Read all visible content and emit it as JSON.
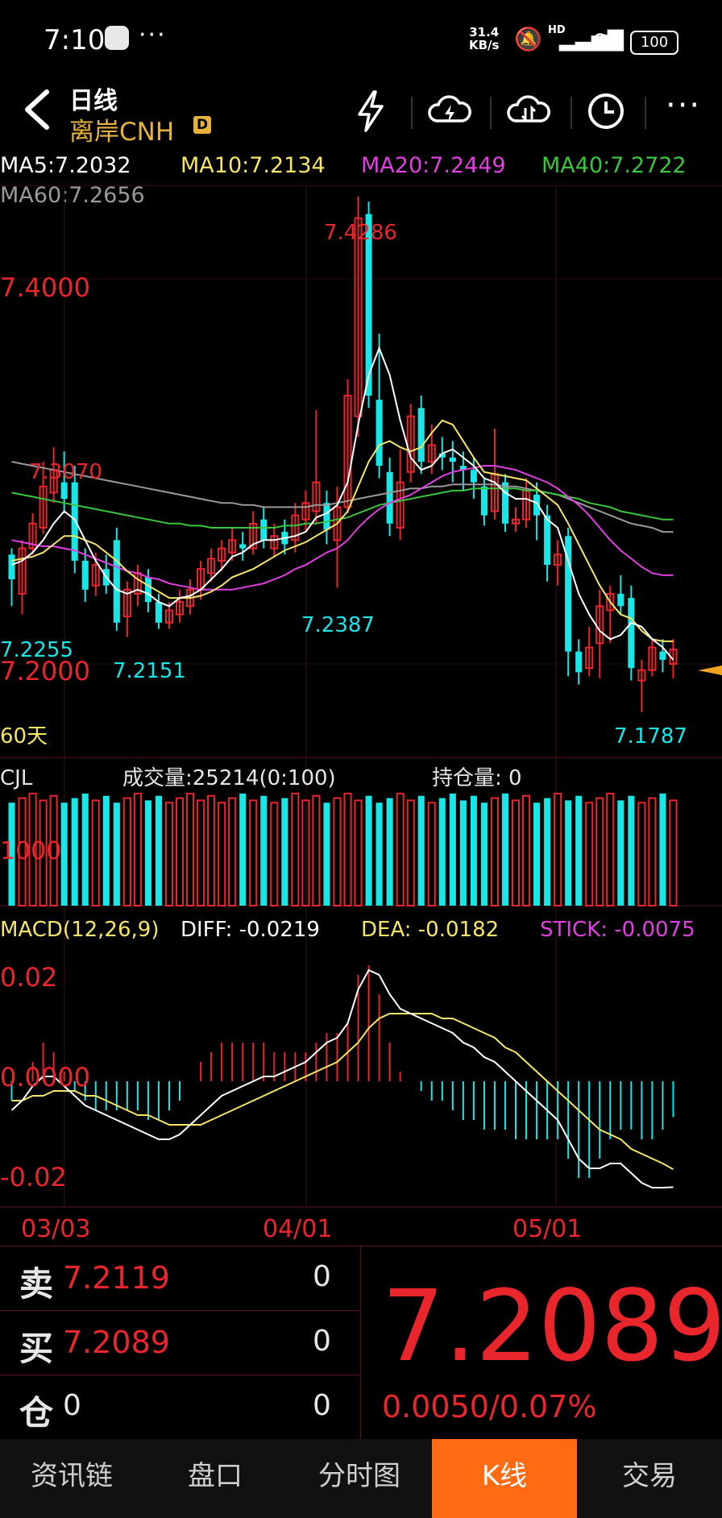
{
  "status_bar": {
    "time": "7:10",
    "net_rate_top": "31.4",
    "net_rate_bottom": "KB/s",
    "signal": "HD",
    "battery": "100"
  },
  "header": {
    "line1": "日线",
    "line2": "离岸CNH",
    "badge": "D"
  },
  "ma_line1": [
    {
      "label": "MA5:7.2032",
      "color": "#ffffff"
    },
    {
      "label": "MA10:7.2134",
      "color": "#f5e66a"
    },
    {
      "label": "MA20:7.2449",
      "color": "#e040e0"
    },
    {
      "label": "MA40:7.2722",
      "color": "#3cc43c"
    }
  ],
  "ma_line2": {
    "label": "MA60:7.2656",
    "color": "#9a9a9a"
  },
  "price_axis": {
    "top_label": "7.4000",
    "bottom_label": "7.2000",
    "period": "60天"
  },
  "price_annotations": {
    "high": "7.4286",
    "p1": "7.3070",
    "p2": "7.2387",
    "p3": "7.2255",
    "p4": "7.2151",
    "low": "7.1787"
  },
  "volume": {
    "title": "CJL",
    "volume_text": "成交量:25214(0:100)",
    "oi_text": "持仓量: 0",
    "axis_label": "1000"
  },
  "macd": {
    "title": "MACD(12,26,9)",
    "diff": "DIFF: -0.0219",
    "dea": "DEA: -0.0182",
    "stick": "STICK: -0.0075",
    "axis_top": "0.02",
    "axis_mid": "0.0000",
    "axis_bottom": "-0.02"
  },
  "dates": [
    "03/03",
    "04/01",
    "05/01"
  ],
  "quote": {
    "sell_label": "卖",
    "sell_price": "7.2119",
    "sell_vol": "0",
    "buy_label": "买",
    "buy_price": "7.2089",
    "buy_vol": "0",
    "pos_label": "仓",
    "pos_value": "0",
    "pos_vol": "0",
    "last_price": "7.2089",
    "change": "0.0050/0.07%"
  },
  "nav": [
    {
      "label": "资讯链",
      "active": false
    },
    {
      "label": "盘口",
      "active": false
    },
    {
      "label": "分时图",
      "active": false
    },
    {
      "label": "K线",
      "active": true
    },
    {
      "label": "交易",
      "active": false
    }
  ],
  "colors": {
    "up": "#e8262b",
    "down": "#19e6e6",
    "accent": "#e7b23c",
    "nav_active": "#ff6a13"
  },
  "chart_data": {
    "type": "candlestick",
    "price_ylim": [
      7.17,
      7.43
    ],
    "x_ticks": [
      "03/03",
      "04/01",
      "05/01"
    ],
    "candles": [
      {
        "o": 7.255,
        "c": 7.243,
        "h": 7.258,
        "l": 7.23
      },
      {
        "o": 7.236,
        "c": 7.258,
        "h": 7.262,
        "l": 7.226
      },
      {
        "o": 7.258,
        "c": 7.27,
        "h": 7.275,
        "l": 7.255
      },
      {
        "o": 7.268,
        "c": 7.288,
        "h": 7.3,
        "l": 7.265
      },
      {
        "o": 7.285,
        "c": 7.296,
        "h": 7.307,
        "l": 7.28
      },
      {
        "o": 7.29,
        "c": 7.282,
        "h": 7.305,
        "l": 7.275
      },
      {
        "o": 7.29,
        "c": 7.252,
        "h": 7.298,
        "l": 7.246
      },
      {
        "o": 7.252,
        "c": 7.238,
        "h": 7.258,
        "l": 7.232
      },
      {
        "o": 7.24,
        "c": 7.25,
        "h": 7.256,
        "l": 7.235
      },
      {
        "o": 7.248,
        "c": 7.24,
        "h": 7.255,
        "l": 7.236
      },
      {
        "o": 7.262,
        "c": 7.222,
        "h": 7.268,
        "l": 7.218
      },
      {
        "o": 7.225,
        "c": 7.238,
        "h": 7.242,
        "l": 7.215
      },
      {
        "o": 7.236,
        "c": 7.246,
        "h": 7.25,
        "l": 7.23
      },
      {
        "o": 7.244,
        "c": 7.232,
        "h": 7.248,
        "l": 7.227
      },
      {
        "o": 7.232,
        "c": 7.222,
        "h": 7.236,
        "l": 7.219
      },
      {
        "o": 7.222,
        "c": 7.228,
        "h": 7.232,
        "l": 7.219
      },
      {
        "o": 7.226,
        "c": 7.232,
        "h": 7.238,
        "l": 7.222
      },
      {
        "o": 7.23,
        "c": 7.238,
        "h": 7.243,
        "l": 7.226
      },
      {
        "o": 7.238,
        "c": 7.248,
        "h": 7.252,
        "l": 7.233
      },
      {
        "o": 7.246,
        "c": 7.253,
        "h": 7.258,
        "l": 7.242
      },
      {
        "o": 7.252,
        "c": 7.258,
        "h": 7.262,
        "l": 7.247
      },
      {
        "o": 7.256,
        "c": 7.262,
        "h": 7.268,
        "l": 7.252
      },
      {
        "o": 7.26,
        "c": 7.258,
        "h": 7.266,
        "l": 7.252
      },
      {
        "o": 7.258,
        "c": 7.27,
        "h": 7.276,
        "l": 7.255
      },
      {
        "o": 7.272,
        "c": 7.262,
        "h": 7.278,
        "l": 7.258
      },
      {
        "o": 7.258,
        "c": 7.264,
        "h": 7.27,
        "l": 7.254
      },
      {
        "o": 7.266,
        "c": 7.26,
        "h": 7.272,
        "l": 7.255
      },
      {
        "o": 7.262,
        "c": 7.274,
        "h": 7.28,
        "l": 7.256
      },
      {
        "o": 7.272,
        "c": 7.28,
        "h": 7.286,
        "l": 7.266
      },
      {
        "o": 7.276,
        "c": 7.29,
        "h": 7.325,
        "l": 7.27
      },
      {
        "o": 7.28,
        "c": 7.267,
        "h": 7.286,
        "l": 7.26
      },
      {
        "o": 7.262,
        "c": 7.278,
        "h": 7.288,
        "l": 7.239
      },
      {
        "o": 7.278,
        "c": 7.332,
        "h": 7.34,
        "l": 7.275
      },
      {
        "o": 7.322,
        "c": 7.418,
        "h": 7.4286,
        "l": 7.312
      },
      {
        "o": 7.42,
        "c": 7.332,
        "h": 7.426,
        "l": 7.326
      },
      {
        "o": 7.33,
        "c": 7.298,
        "h": 7.362,
        "l": 7.292
      },
      {
        "o": 7.295,
        "c": 7.27,
        "h": 7.302,
        "l": 7.264
      },
      {
        "o": 7.268,
        "c": 7.29,
        "h": 7.306,
        "l": 7.262
      },
      {
        "o": 7.295,
        "c": 7.322,
        "h": 7.328,
        "l": 7.29
      },
      {
        "o": 7.326,
        "c": 7.3,
        "h": 7.332,
        "l": 7.294
      },
      {
        "o": 7.3,
        "c": 7.308,
        "h": 7.318,
        "l": 7.294
      },
      {
        "o": 7.304,
        "c": 7.302,
        "h": 7.312,
        "l": 7.296
      },
      {
        "o": 7.302,
        "c": 7.3,
        "h": 7.31,
        "l": 7.29
      },
      {
        "o": 7.298,
        "c": 7.296,
        "h": 7.305,
        "l": 7.286
      },
      {
        "o": 7.296,
        "c": 7.29,
        "h": 7.302,
        "l": 7.282
      },
      {
        "o": 7.288,
        "c": 7.274,
        "h": 7.292,
        "l": 7.269
      },
      {
        "o": 7.276,
        "c": 7.294,
        "h": 7.316,
        "l": 7.272
      },
      {
        "o": 7.29,
        "c": 7.27,
        "h": 7.294,
        "l": 7.266
      },
      {
        "o": 7.27,
        "c": 7.272,
        "h": 7.278,
        "l": 7.266
      },
      {
        "o": 7.272,
        "c": 7.286,
        "h": 7.292,
        "l": 7.268
      },
      {
        "o": 7.284,
        "c": 7.274,
        "h": 7.29,
        "l": 7.262
      },
      {
        "o": 7.274,
        "c": 7.25,
        "h": 7.279,
        "l": 7.242
      },
      {
        "o": 7.25,
        "c": 7.255,
        "h": 7.262,
        "l": 7.24
      },
      {
        "o": 7.264,
        "c": 7.208,
        "h": 7.268,
        "l": 7.196
      },
      {
        "o": 7.208,
        "c": 7.198,
        "h": 7.214,
        "l": 7.192
      },
      {
        "o": 7.2,
        "c": 7.21,
        "h": 7.22,
        "l": 7.196
      },
      {
        "o": 7.212,
        "c": 7.23,
        "h": 7.238,
        "l": 7.195
      },
      {
        "o": 7.228,
        "c": 7.236,
        "h": 7.24,
        "l": 7.212
      },
      {
        "o": 7.236,
        "c": 7.23,
        "h": 7.245,
        "l": 7.226
      },
      {
        "o": 7.234,
        "c": 7.2,
        "h": 7.24,
        "l": 7.194
      },
      {
        "o": 7.194,
        "c": 7.199,
        "h": 7.204,
        "l": 7.1787
      },
      {
        "o": 7.199,
        "c": 7.21,
        "h": 7.214,
        "l": 7.196
      },
      {
        "o": 7.208,
        "c": 7.204,
        "h": 7.214,
        "l": 7.198
      },
      {
        "o": 7.202,
        "c": 7.209,
        "h": 7.214,
        "l": 7.195
      }
    ],
    "ma5": [
      7.25,
      7.252,
      7.256,
      7.262,
      7.27,
      7.276,
      7.272,
      7.262,
      7.252,
      7.244,
      7.238,
      7.236,
      7.238,
      7.236,
      7.232,
      7.23,
      7.234,
      7.235,
      7.238,
      7.243,
      7.248,
      7.254,
      7.256,
      7.26,
      7.262,
      7.262,
      7.263,
      7.264,
      7.266,
      7.273,
      7.275,
      7.279,
      7.29,
      7.318,
      7.342,
      7.355,
      7.342,
      7.32,
      7.302,
      7.296,
      7.298,
      7.304,
      7.306,
      7.302,
      7.298,
      7.292,
      7.29,
      7.285,
      7.282,
      7.282,
      7.28,
      7.272,
      7.268,
      7.252,
      7.236,
      7.226,
      7.218,
      7.214,
      7.216,
      7.222,
      7.22,
      7.214,
      7.21,
      7.204
    ],
    "ma10": [
      7.252,
      7.253,
      7.254,
      7.256,
      7.26,
      7.264,
      7.264,
      7.262,
      7.26,
      7.256,
      7.252,
      7.247,
      7.243,
      7.24,
      7.237,
      7.234,
      7.234,
      7.234,
      7.235,
      7.237,
      7.24,
      7.244,
      7.246,
      7.248,
      7.251,
      7.254,
      7.257,
      7.259,
      7.261,
      7.264,
      7.267,
      7.27,
      7.276,
      7.288,
      7.3,
      7.308,
      7.31,
      7.307,
      7.305,
      7.307,
      7.314,
      7.32,
      7.318,
      7.31,
      7.302,
      7.295,
      7.294,
      7.293,
      7.292,
      7.291,
      7.287,
      7.283,
      7.279,
      7.27,
      7.26,
      7.25,
      7.24,
      7.232,
      7.226,
      7.224,
      7.218,
      7.214,
      7.213,
      7.213
    ],
    "ma20": [
      7.262,
      7.261,
      7.26,
      7.259,
      7.259,
      7.258,
      7.257,
      7.255,
      7.253,
      7.251,
      7.249,
      7.247,
      7.246,
      7.244,
      7.243,
      7.241,
      7.24,
      7.239,
      7.238,
      7.238,
      7.238,
      7.238,
      7.239,
      7.24,
      7.241,
      7.243,
      7.245,
      7.248,
      7.25,
      7.253,
      7.256,
      7.258,
      7.262,
      7.268,
      7.273,
      7.277,
      7.28,
      7.282,
      7.284,
      7.287,
      7.29,
      7.293,
      7.295,
      7.296,
      7.297,
      7.298,
      7.298,
      7.297,
      7.296,
      7.294,
      7.292,
      7.29,
      7.287,
      7.283,
      7.279,
      7.274,
      7.268,
      7.262,
      7.257,
      7.253,
      7.249,
      7.246,
      7.245,
      7.245
    ],
    "ma40": [
      7.285,
      7.284,
      7.283,
      7.282,
      7.281,
      7.28,
      7.279,
      7.278,
      7.277,
      7.276,
      7.275,
      7.274,
      7.273,
      7.272,
      7.271,
      7.27,
      7.27,
      7.269,
      7.269,
      7.268,
      7.268,
      7.268,
      7.268,
      7.268,
      7.268,
      7.268,
      7.269,
      7.269,
      7.27,
      7.27,
      7.271,
      7.272,
      7.273,
      7.275,
      7.277,
      7.279,
      7.28,
      7.281,
      7.282,
      7.283,
      7.284,
      7.285,
      7.286,
      7.286,
      7.287,
      7.287,
      7.287,
      7.287,
      7.287,
      7.286,
      7.286,
      7.285,
      7.284,
      7.283,
      7.282,
      7.28,
      7.279,
      7.278,
      7.276,
      7.275,
      7.274,
      7.273,
      7.272,
      7.272
    ],
    "ma60": [
      7.3,
      7.299,
      7.298,
      7.297,
      7.296,
      7.295,
      7.294,
      7.293,
      7.292,
      7.291,
      7.29,
      7.289,
      7.288,
      7.287,
      7.286,
      7.285,
      7.284,
      7.283,
      7.282,
      7.281,
      7.28,
      7.28,
      7.279,
      7.279,
      7.278,
      7.278,
      7.278,
      7.278,
      7.278,
      7.279,
      7.279,
      7.28,
      7.281,
      7.282,
      7.283,
      7.284,
      7.285,
      7.286,
      7.287,
      7.287,
      7.288,
      7.288,
      7.289,
      7.289,
      7.289,
      7.289,
      7.289,
      7.288,
      7.288,
      7.287,
      7.286,
      7.285,
      7.284,
      7.282,
      7.28,
      7.278,
      7.276,
      7.274,
      7.272,
      7.27,
      7.269,
      7.268,
      7.266,
      7.266
    ],
    "volume_ylim": [
      0,
      2000
    ],
    "macd_ylim": [
      -0.025,
      0.028
    ],
    "macd_diff": [
      -0.006,
      -0.004,
      -0.001,
      0.001,
      0.001,
      -0.001,
      -0.003,
      -0.005,
      -0.006,
      -0.007,
      -0.008,
      -0.009,
      -0.01,
      -0.011,
      -0.012,
      -0.012,
      -0.011,
      -0.009,
      -0.007,
      -0.005,
      -0.003,
      -0.002,
      -0.001,
      0.0,
      0.001,
      0.001,
      0.002,
      0.003,
      0.004,
      0.006,
      0.008,
      0.009,
      0.012,
      0.019,
      0.023,
      0.022,
      0.018,
      0.015,
      0.014,
      0.013,
      0.012,
      0.011,
      0.01,
      0.008,
      0.007,
      0.005,
      0.004,
      0.002,
      0.0,
      -0.002,
      -0.004,
      -0.006,
      -0.008,
      -0.012,
      -0.016,
      -0.018,
      -0.018,
      -0.017,
      -0.017,
      -0.019,
      -0.021,
      -0.022,
      -0.022,
      -0.0219
    ],
    "macd_dea": [
      -0.004,
      -0.004,
      -0.003,
      -0.003,
      -0.002,
      -0.002,
      -0.002,
      -0.003,
      -0.003,
      -0.004,
      -0.005,
      -0.006,
      -0.007,
      -0.007,
      -0.008,
      -0.009,
      -0.009,
      -0.009,
      -0.009,
      -0.008,
      -0.007,
      -0.006,
      -0.005,
      -0.004,
      -0.003,
      -0.002,
      -0.001,
      0.0,
      0.001,
      0.002,
      0.003,
      0.004,
      0.006,
      0.008,
      0.011,
      0.013,
      0.014,
      0.014,
      0.014,
      0.014,
      0.014,
      0.013,
      0.013,
      0.012,
      0.011,
      0.01,
      0.009,
      0.007,
      0.006,
      0.004,
      0.002,
      0.0,
      -0.002,
      -0.004,
      -0.006,
      -0.008,
      -0.01,
      -0.011,
      -0.012,
      -0.014,
      -0.015,
      -0.016,
      -0.017,
      -0.0182
    ]
  }
}
